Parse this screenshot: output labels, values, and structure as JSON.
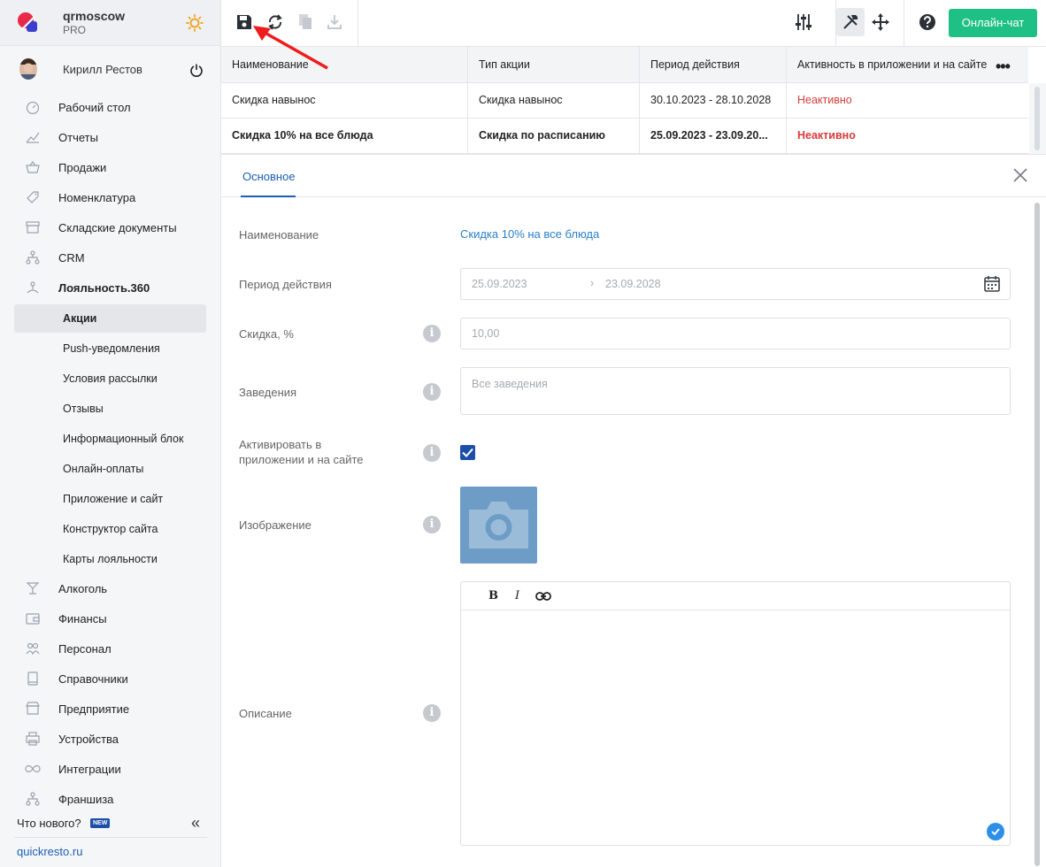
{
  "brand": {
    "name": "qrmoscow",
    "plan": "PRO"
  },
  "user": {
    "name": "Кирилл Рестов"
  },
  "sidebar": {
    "items": [
      {
        "label": "Рабочий стол",
        "icon": "gauge-icon"
      },
      {
        "label": "Отчеты",
        "icon": "chart-line-icon"
      },
      {
        "label": "Продажи",
        "icon": "basket-icon"
      },
      {
        "label": "Номенклатура",
        "icon": "tag-icon"
      },
      {
        "label": "Складские документы",
        "icon": "archive-icon"
      },
      {
        "label": "CRM",
        "icon": "hierarchy-icon"
      },
      {
        "label": "Лояльность.360",
        "icon": "loyalty-icon"
      }
    ],
    "subitems": [
      {
        "label": "Акции"
      },
      {
        "label": "Push-уведомления"
      },
      {
        "label": "Условия рассылки"
      },
      {
        "label": "Отзывы"
      },
      {
        "label": "Информационный блок"
      },
      {
        "label": "Онлайн-оплаты"
      },
      {
        "label": "Приложение и сайт"
      },
      {
        "label": "Конструктор сайта"
      },
      {
        "label": "Карты лояльности"
      }
    ],
    "items2": [
      {
        "label": "Алкоголь",
        "icon": "glass-icon"
      },
      {
        "label": "Финансы",
        "icon": "wallet-icon"
      },
      {
        "label": "Персонал",
        "icon": "people-icon"
      },
      {
        "label": "Справочники",
        "icon": "book-icon"
      },
      {
        "label": "Предприятие",
        "icon": "store-icon"
      },
      {
        "label": "Устройства",
        "icon": "printer-icon"
      },
      {
        "label": "Интеграции",
        "icon": "infinity-icon"
      },
      {
        "label": "Франшиза",
        "icon": "hierarchy-icon"
      }
    ],
    "whats_new": "Что нового?",
    "new_badge": "NEW",
    "site_link": "quickresto.ru"
  },
  "toolbar": {
    "chat_label": "Онлайн-чат"
  },
  "table": {
    "columns": [
      "Наименование",
      "Тип акции",
      "Период действия",
      "Активность в приложении и на сайте"
    ],
    "rows": [
      [
        "Скидка навынос",
        "Скидка навынос",
        "30.10.2023 - 28.10.2028",
        "Неактивно"
      ],
      [
        "Скидка 10% на все блюда",
        "Скидка по расписанию",
        "25.09.2023 - 23.09.20...",
        "Неактивно"
      ]
    ]
  },
  "tabs": {
    "main": "Основное"
  },
  "form": {
    "name_label": "Наименование",
    "name_value": "Скидка 10% на все блюда",
    "period_label": "Период действия",
    "period_from": "25.09.2023",
    "period_to": "23.09.2028",
    "discount_label": "Скидка, %",
    "discount_value": "10,00",
    "venues_label": "Заведения",
    "venues_placeholder": "Все заведения",
    "activate_label": "Активировать в приложении и на сайте",
    "activate_checked": true,
    "image_label": "Изображение",
    "description_label": "Описание"
  },
  "colors": {
    "accent": "#1c4fa8",
    "chat": "#1fc086",
    "inactive": "#d63b3b",
    "link": "#2a7fc6"
  }
}
